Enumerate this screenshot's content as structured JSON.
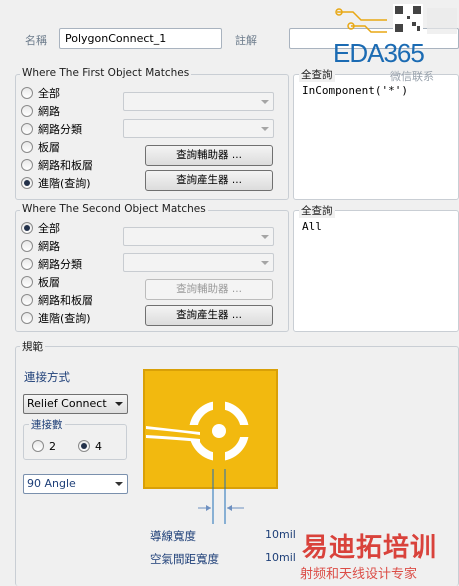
{
  "header": {
    "name_label": "名稱",
    "name_value": "PolygonConnect_1",
    "comment_label": "註解",
    "comment_value": ""
  },
  "first_object": {
    "title": "Where The First Object Matches",
    "options": [
      "全部",
      "網路",
      "網路分類",
      "板層",
      "網路和板層",
      "進階(查詢)"
    ],
    "selected_index": 5,
    "helper_button": "查詢輔助器 ...",
    "builder_button": "查詢產生器 ...",
    "query_title": "全查詢",
    "query_text": "InComponent('*')"
  },
  "second_object": {
    "title": "Where The Second Object Matches",
    "options": [
      "全部",
      "網路",
      "網路分類",
      "板層",
      "網路和板層",
      "進階(查詢)"
    ],
    "selected_index": 0,
    "helper_button": "查詢輔助器 ...",
    "builder_button": "查詢產生器 ...",
    "query_title": "全查詢",
    "query_text": "All"
  },
  "constraints": {
    "title": "規範",
    "connect_style_label": "連接方式",
    "connect_style_value": "Relief Connect",
    "conductors_title": "連接數",
    "conductor_options": [
      "2",
      "4"
    ],
    "conductors_selected": "4",
    "angle_value": "90 Angle",
    "conductor_width_label": "導線寬度",
    "conductor_width_value": "10mil",
    "air_gap_label": "空氣間距寬度",
    "air_gap_value": "10mil"
  },
  "watermark": {
    "logo_text": "EDA365",
    "logo_sub": "微信联系",
    "brand_cn": "易迪拓培训",
    "brand_sub": "射频和天线设计专家"
  },
  "colors": {
    "pad_gold": "#f2b90f",
    "pad_edge": "#d9a007",
    "pad_gap": "#ffffff",
    "dimension_line": "#1f6fb8",
    "watermark_red": "#d6241c",
    "logo_blue": "#1b6bb3"
  }
}
